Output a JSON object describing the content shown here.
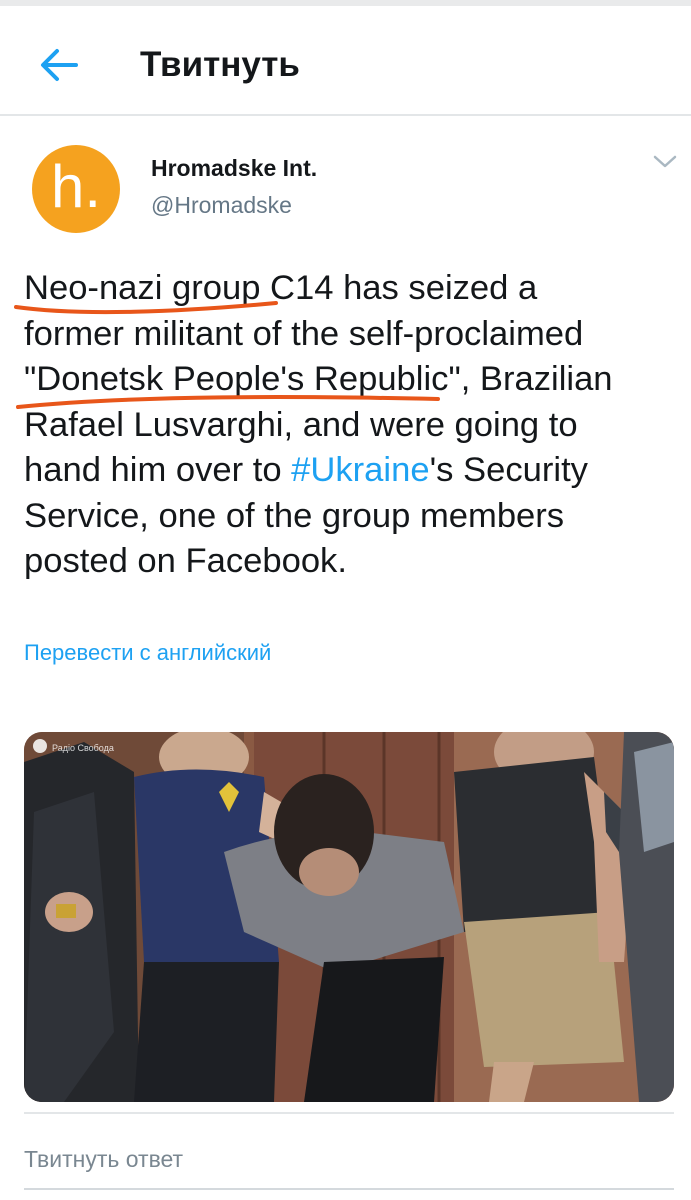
{
  "header": {
    "title": "Твитнуть",
    "back_icon": "arrow-left-icon"
  },
  "tweet": {
    "author_name": "Hromadske Int.",
    "author_handle": "@Hromadske",
    "avatar_letter": "h.",
    "avatar_color": "#F5A21F",
    "text_lines": [
      {
        "text": "Neo-nazi group C14 has seized a"
      },
      {
        "text": "former militant of the self-proclaimed"
      },
      {
        "text": "\"Donetsk People's Republic\", Brazilian"
      },
      {
        "text": "Rafael Lusvarghi, and were going to"
      },
      {
        "before": "hand him over to ",
        "hashtag": "#Ukraine",
        "after": "'s Security"
      },
      {
        "text": "Service, one of the group members"
      },
      {
        "text": "posted on Facebook."
      }
    ],
    "translate_link": "Перевести с английский",
    "image_watermark": "Радіо Свобода"
  },
  "reply": {
    "placeholder": "Твитнуть ответ"
  },
  "colors": {
    "accent": "#1DA1F2",
    "underline": "#E8561A",
    "text": "#14171A",
    "secondary": "#657786"
  }
}
